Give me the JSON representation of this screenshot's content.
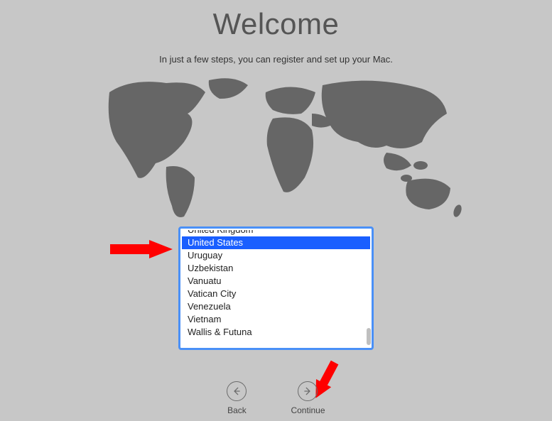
{
  "header": {
    "title": "Welcome",
    "subtitle": "In just a few steps, you can register and set up your Mac."
  },
  "countries": {
    "partial_top": "United Kingdom",
    "selected": "United States",
    "visible": [
      "United States",
      "Uruguay",
      "Uzbekistan",
      "Vanuatu",
      "Vatican City",
      "Venezuela",
      "Vietnam",
      "Wallis & Futuna"
    ]
  },
  "nav": {
    "back": "Back",
    "continue": "Continue"
  }
}
